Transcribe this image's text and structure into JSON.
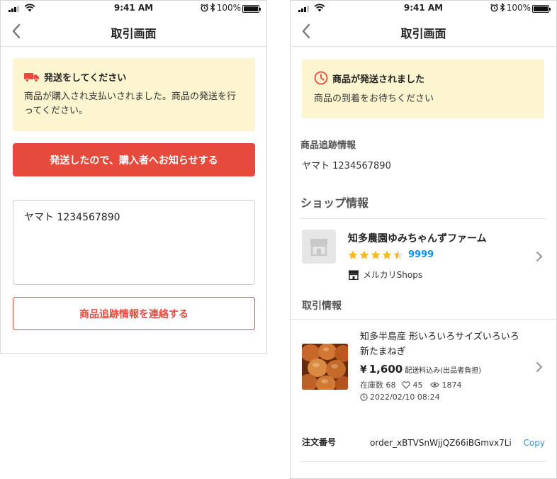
{
  "colors": {
    "accent_red": "#e64a3c",
    "notice_yellow": "#fdf5cf",
    "star_gold": "#f8b71c",
    "link_blue": "#0095ee"
  },
  "status_bar": {
    "time": "9:41 AM",
    "battery": "100%",
    "icons": [
      "signal-icon",
      "wifi-icon",
      "alarm-icon",
      "bluetooth-icon",
      "battery-icon"
    ]
  },
  "screen1": {
    "nav": {
      "title": "取引画面",
      "back_icon": "chevron-left-icon"
    },
    "notice": {
      "icon": "truck-icon",
      "title": "発送をしてください",
      "body": "商品が購入され支払いされました。商品の発送を行ってください。"
    },
    "notify_button": "発送したので、購入者へお知らせする",
    "tracking_input": {
      "value": "ヤマト 1234567890"
    },
    "send_tracking_button": "商品追跡情報を連絡する"
  },
  "screen2": {
    "nav": {
      "title": "取引画面",
      "back_icon": "chevron-left-icon"
    },
    "notice": {
      "icon": "clock-icon",
      "title": "商品が発送されました",
      "body": "商品の到着をお待ちください"
    },
    "tracking": {
      "label": "商品追跡情報",
      "value": "ヤマト 1234567890"
    },
    "shop_section": {
      "title": "ショップ情報",
      "shop_name": "知多農園ゆみちゃんずファーム",
      "rating": 4.5,
      "rating_count": "9999",
      "badge": "メルカリShops"
    },
    "transaction_section": {
      "title": "取引情報",
      "item": {
        "title": "知多半島産 形いろいろサイズいろいろ 新たまねぎ",
        "currency": "¥",
        "price": "1,600",
        "shipping": "配送料込み(出品者負担)",
        "stock": "在庫数 68",
        "likes": "45",
        "views": "1874",
        "date": "2022/02/10 08:24"
      }
    },
    "order": {
      "label": "注文番号",
      "number": "order_xBTVSnWjjQZ66iBGmvx7Li",
      "copy": "Copy"
    }
  }
}
